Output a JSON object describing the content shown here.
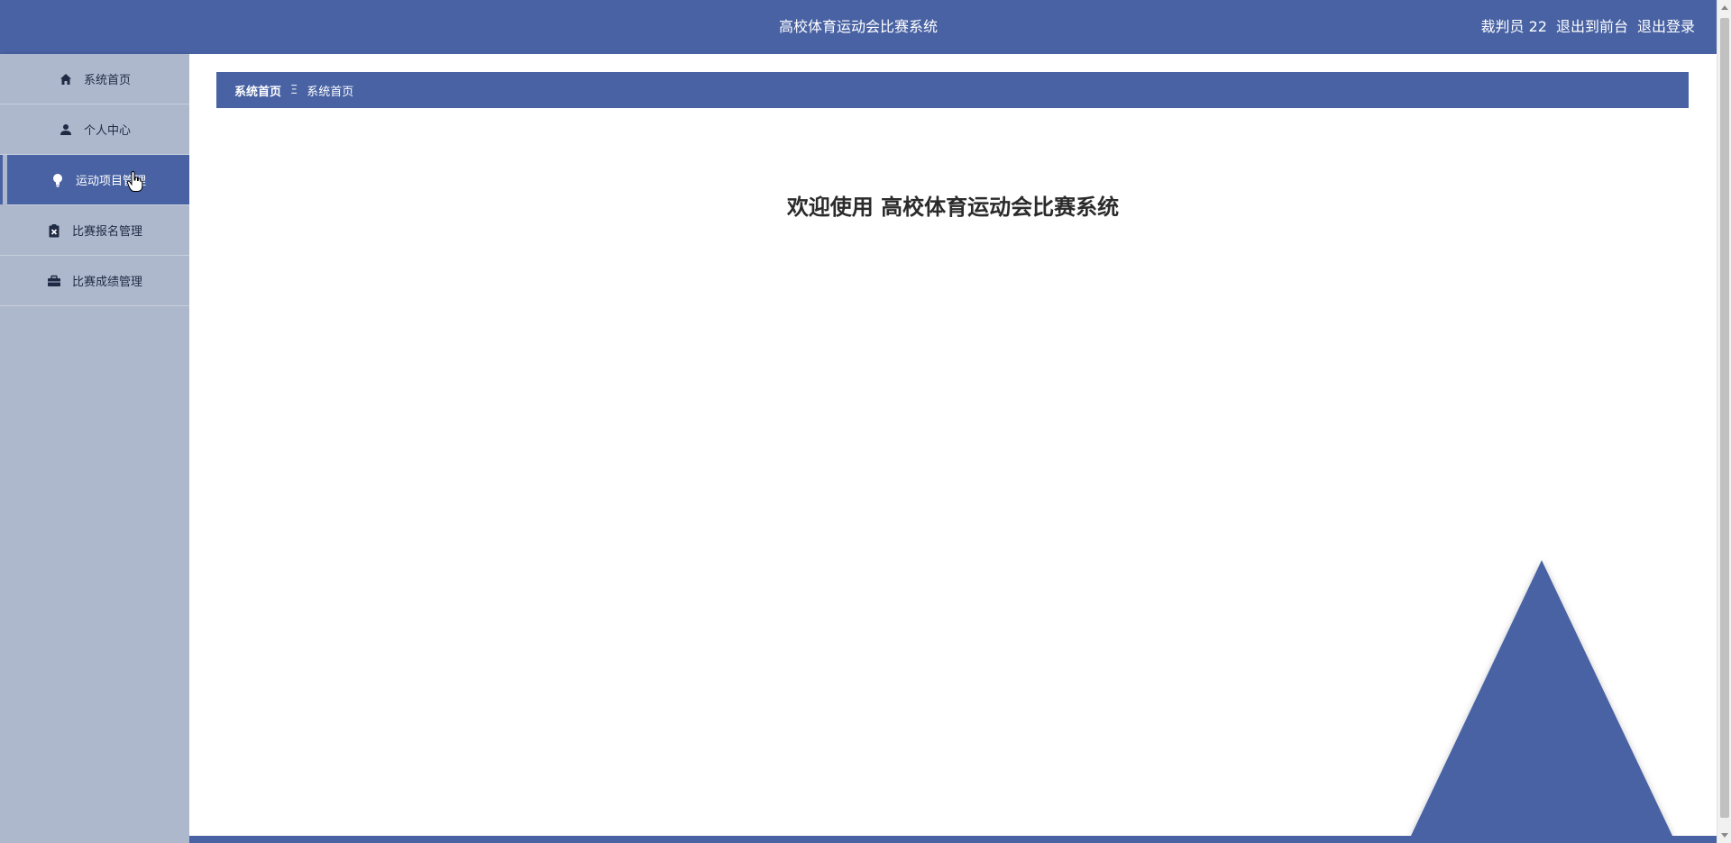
{
  "app": {
    "title": "高校体育运动会比赛系统"
  },
  "topbar": {
    "user": "裁判员 22",
    "front_link": "退出到前台",
    "logout_link": "退出登录"
  },
  "sidebar": {
    "items": [
      {
        "label": "系统首页",
        "icon": "home-icon"
      },
      {
        "label": "个人中心",
        "icon": "user-icon"
      },
      {
        "label": "运动项目管理",
        "icon": "lightbulb-icon"
      },
      {
        "label": "比赛报名管理",
        "icon": "clipboard-x-icon"
      },
      {
        "label": "比赛成绩管理",
        "icon": "briefcase-icon"
      }
    ],
    "active_index": 2
  },
  "breadcrumb": {
    "home": "系统首页",
    "separator": "Ξ",
    "current": "系统首页"
  },
  "main": {
    "welcome": "欢迎使用 高校体育运动会比赛系统"
  },
  "colors": {
    "primary": "#4862a3",
    "sidebar_bg": "#aeb8cc",
    "text_dark": "#2b2b2b"
  }
}
